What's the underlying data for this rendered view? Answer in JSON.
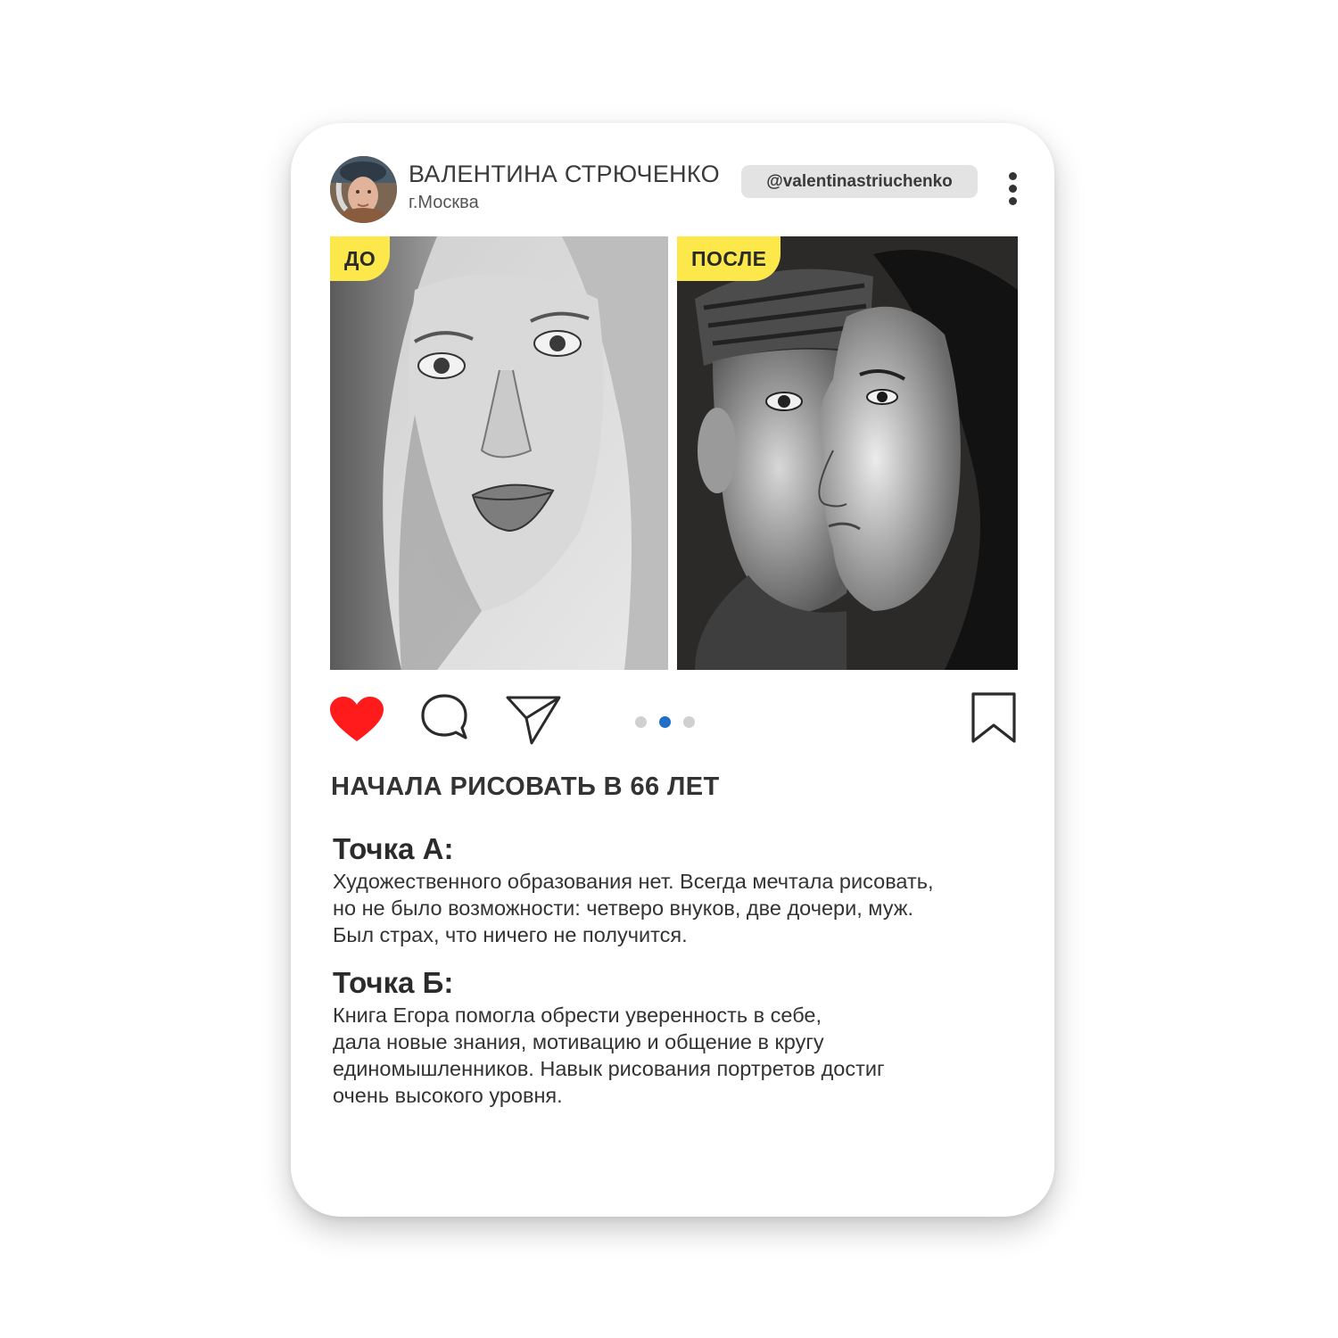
{
  "post": {
    "author": {
      "name": "ВАЛЕНТИНА СТРЮЧЕНКО",
      "city": "г.Москва",
      "handle": "@valentinastriuchenko"
    },
    "images": {
      "before_label": "ДО",
      "after_label": "ПОСЛЕ"
    },
    "actions": {
      "like_icon": "heart-icon",
      "comment_icon": "comment-bubble-icon",
      "share_icon": "paper-plane-icon",
      "save_icon": "bookmark-icon",
      "liked": true
    },
    "carousel": {
      "count": 3,
      "active_index": 1
    },
    "headline": "НАЧАЛА РИСОВАТЬ В 66 ЛЕТ",
    "point_a": {
      "title": "Точка А:",
      "lines": [
        "Художественного образования нет. Всегда мечтала рисовать,",
        "но не было возможности: четверо внуков, две дочери, муж.",
        "Был страх, что ничего не получится."
      ]
    },
    "point_b": {
      "title": "Точка Б:",
      "lines": [
        "Книга Егора помогла обрести уверенность в себе,",
        "дала новые знания, мотивацию и общение в кругу",
        "единомышленников. Навык рисования портретов достиг",
        "очень высокого уровня."
      ]
    }
  },
  "colors": {
    "like_red": "#ff1b1b",
    "tag_yellow": "#fde84b",
    "dot_active": "#1f6fc6",
    "dot_inactive": "#d0d0d0",
    "text_dark": "#333333",
    "handle_bg": "#e3e3e3"
  }
}
